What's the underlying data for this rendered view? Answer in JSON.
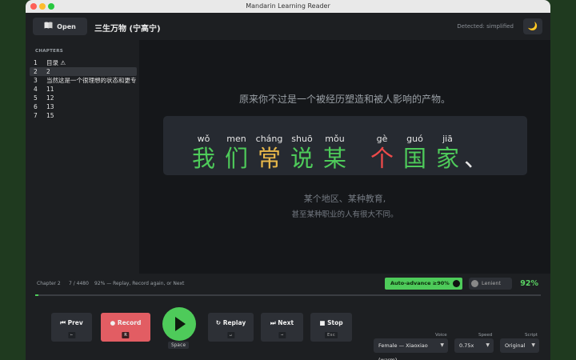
{
  "window": {
    "title": "Mandarin Learning Reader"
  },
  "toolbar": {
    "open_label": "Open",
    "book_title": "三生万物 (宁高宁)",
    "detected": "Detected: simplified",
    "theme_icon": "🌙"
  },
  "sidebar": {
    "heading": "CHAPTERS",
    "items": [
      {
        "num": "1",
        "title": "目录  ⚠"
      },
      {
        "num": "2",
        "title": "2"
      },
      {
        "num": "3",
        "title": "当然这是一个很理想的状态和更专业"
      },
      {
        "num": "4",
        "title": "11"
      },
      {
        "num": "5",
        "title": "12"
      },
      {
        "num": "6",
        "title": "13"
      },
      {
        "num": "7",
        "title": "15"
      }
    ],
    "selected_index": 1
  },
  "reader": {
    "context_before": "原来你不过是一个被经历塑造和被人影响的产物。",
    "sentence": [
      {
        "pinyin": "wǒ",
        "hanzi": "我",
        "state": "correct"
      },
      {
        "pinyin": "men",
        "hanzi": "们",
        "state": "correct"
      },
      {
        "pinyin": "cháng",
        "hanzi": "常",
        "state": "partial"
      },
      {
        "pinyin": "shuō",
        "hanzi": "说",
        "state": "correct"
      },
      {
        "pinyin": "mǒu",
        "hanzi": "某",
        "state": "correct"
      },
      {
        "pinyin": "",
        "hanzi": "",
        "state": "space"
      },
      {
        "pinyin": "gè",
        "hanzi": "个",
        "state": "wrong"
      },
      {
        "pinyin": "guó",
        "hanzi": "国",
        "state": "correct"
      },
      {
        "pinyin": "jiā",
        "hanzi": "家",
        "state": "correct"
      },
      {
        "pinyin": "",
        "hanzi": "、",
        "state": "punct"
      }
    ],
    "context_after_1": "某个地区、某种教育,",
    "context_after_2": "甚至某种职业的人有很大不同。"
  },
  "status": {
    "chapter": "Chapter 2",
    "position": "7 / 4480",
    "message": "92% — Replay, Record again, or Next",
    "auto_advance": "Auto-advance ≥90%",
    "lenient": "Lenient",
    "score": "92%"
  },
  "progress": {
    "fraction": 0.0016
  },
  "controls": {
    "prev": {
      "label": "Prev",
      "key": "←"
    },
    "record": {
      "label": "Record",
      "key": "R"
    },
    "play_key": "Space",
    "replay": {
      "label": "Replay",
      "key": "↵"
    },
    "next": {
      "label": "Next",
      "key": "→"
    },
    "stop": {
      "label": "Stop",
      "key": "Esc"
    },
    "voice": {
      "label": "Voice",
      "value": "Female — Xiaoxiao (warm)"
    },
    "speed": {
      "label": "Speed",
      "value": "0.75x"
    },
    "script": {
      "label": "Script",
      "value": "Original"
    }
  },
  "colors": {
    "correct": "#4ecb5a",
    "partial": "#e8b84a",
    "wrong": "#ef4a4a",
    "accent": "#4ecb5a",
    "record": "#e25d63"
  }
}
